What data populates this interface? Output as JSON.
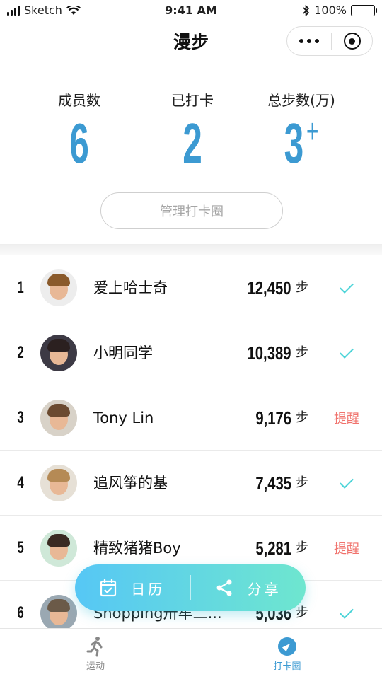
{
  "status_bar": {
    "carrier": "Sketch",
    "time": "9:41 AM",
    "battery_level": "100%",
    "battery_fraction": 1.0
  },
  "header": {
    "title": "漫步",
    "more_icon": "more-dots-icon",
    "close_icon": "target-circle-icon"
  },
  "stats": [
    {
      "label": "成员数",
      "value": "6",
      "suffix": ""
    },
    {
      "label": "已打卡",
      "value": "2",
      "suffix": ""
    },
    {
      "label": "总步数(万)",
      "value": "3",
      "suffix": "+"
    }
  ],
  "manage_button": "管理打卡圈",
  "members": [
    {
      "rank": "1",
      "name": "爱上哈士奇",
      "steps": "12,450",
      "unit": "步",
      "status": "done",
      "hair": "#8a5a2b",
      "bg": "#ededed"
    },
    {
      "rank": "2",
      "name": "小明同学",
      "steps": "10,389",
      "unit": "步",
      "status": "done",
      "hair": "#2b2020",
      "bg": "#3d3a45"
    },
    {
      "rank": "3",
      "name": "Tony Lin",
      "steps": "9,176",
      "unit": "步",
      "status": "remind",
      "status_label": "提醒",
      "hair": "#6b4a30",
      "bg": "#d8d2c8"
    },
    {
      "rank": "4",
      "name": "追风筝的基",
      "steps": "7,435",
      "unit": "步",
      "status": "done",
      "hair": "#b58a55",
      "bg": "#e6e0d6"
    },
    {
      "rank": "5",
      "name": "精致猪猪Boy",
      "steps": "5,281",
      "unit": "步",
      "status": "remind",
      "status_label": "提醒",
      "hair": "#3a2a22",
      "bg": "#cfe8d8"
    },
    {
      "rank": "6",
      "name": "Shopping卅牟二...",
      "steps": "5,036",
      "unit": "步",
      "status": "done",
      "hair": "#6b5a48",
      "bg": "#9aa8b2"
    }
  ],
  "fab": {
    "calendar_label": "日历",
    "share_label": "分享",
    "calendar_icon": "calendar-check-icon",
    "share_icon": "share-icon"
  },
  "tabbar": [
    {
      "label": "运动",
      "icon": "running-person-icon",
      "active": false
    },
    {
      "label": "打卡圈",
      "icon": "compass-icon",
      "active": true
    }
  ],
  "colors": {
    "accent": "#3c9ad2",
    "check": "#4cd4d8",
    "remind": "#f0736d"
  }
}
